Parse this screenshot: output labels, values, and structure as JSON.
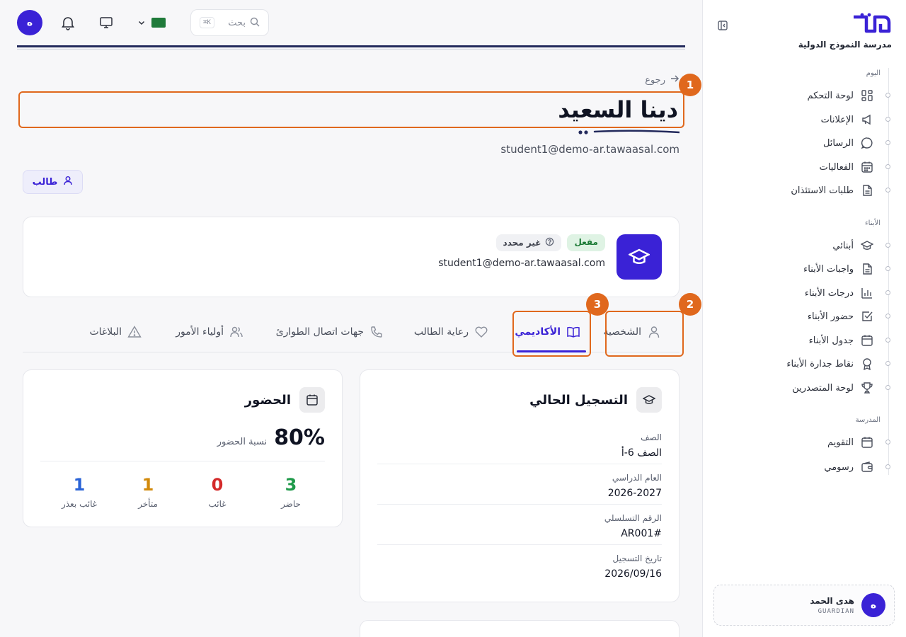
{
  "sidebar": {
    "school_name": "مدرسة النموذج الدولية",
    "sections": [
      {
        "label": "اليوم",
        "items": [
          {
            "label": "لوحة التحكم",
            "icon": "grid-icon"
          },
          {
            "label": "الإعلانات",
            "icon": "megaphone-icon"
          },
          {
            "label": "الرسائل",
            "icon": "chat-icon"
          },
          {
            "label": "الفعاليات",
            "icon": "calendar-grid-icon"
          },
          {
            "label": "طلبات الاستئذان",
            "icon": "document-icon"
          }
        ]
      },
      {
        "label": "الأبناء",
        "items": [
          {
            "label": "أبنائي",
            "icon": "graduation-cap-icon"
          },
          {
            "label": "واجبات الأبناء",
            "icon": "document-icon"
          },
          {
            "label": "درجات الأبناء",
            "icon": "bar-chart-icon"
          },
          {
            "label": "حضور الأبناء",
            "icon": "checkbox-icon"
          },
          {
            "label": "جدول الأبناء",
            "icon": "calendar-icon"
          },
          {
            "label": "نقاط جدارة الأبناء",
            "icon": "award-icon"
          },
          {
            "label": "لوحة المتصدرين",
            "icon": "trophy-icon"
          }
        ]
      },
      {
        "label": "المدرسة",
        "items": [
          {
            "label": "التقويم",
            "icon": "calendar-icon"
          },
          {
            "label": "رسومي",
            "icon": "wallet-icon"
          }
        ]
      }
    ],
    "user": {
      "initial": "ه",
      "name": "هدى الحمد",
      "role": "GUARDIAN"
    }
  },
  "topbar": {
    "avatar_initial": "ه",
    "search_placeholder": "بحث",
    "search_shortcut": "K⌘",
    "flag_text": "🇸🇦"
  },
  "header": {
    "back_label": "رجوع",
    "title": "دينا السعيد",
    "email": "student1@demo-ar.tawaasal.com",
    "role_chip": "طالب"
  },
  "profile_card": {
    "status_active": "مفعل",
    "status_unset": "غير محدد",
    "email": "student1@demo-ar.tawaasal.com"
  },
  "tabs": [
    {
      "label": "الشخصية",
      "icon": "user-icon"
    },
    {
      "label": "الأكاديمي",
      "icon": "book-open-icon"
    },
    {
      "label": "رعاية الطالب",
      "icon": "heart-icon"
    },
    {
      "label": "جهات اتصال الطوارئ",
      "icon": "phone-icon"
    },
    {
      "label": "أولياء الأمور",
      "icon": "users-icon"
    },
    {
      "label": "البلاغات",
      "icon": "alert-triangle-icon"
    }
  ],
  "active_tab": "الأكاديمي",
  "annotations": [
    "1",
    "2",
    "3"
  ],
  "enrollment": {
    "title": "التسجيل الحالي",
    "fields": [
      {
        "label": "الصف",
        "value": "الصف 6-أ"
      },
      {
        "label": "العام الدراسي",
        "value": "2026-2027"
      },
      {
        "label": "الرقم التسلسلي",
        "value": "AR001#"
      },
      {
        "label": "تاريخ التسجيل",
        "value": "2026/09/16"
      }
    ]
  },
  "attendance": {
    "title": "الحضور",
    "percent": "80%",
    "percent_label": "نسبة الحضور",
    "stats": [
      {
        "value": "3",
        "label": "حاضر",
        "color": "#1f9a4a"
      },
      {
        "value": "0",
        "label": "غائب",
        "color": "#d42a2a"
      },
      {
        "value": "1",
        "label": "متأخر",
        "color": "#d28a0c"
      },
      {
        "value": "1",
        "label": "غائب بعذر",
        "color": "#2a63d6"
      }
    ]
  },
  "colors": {
    "accent": "#3a22d6",
    "highlight": "#e0681d"
  }
}
